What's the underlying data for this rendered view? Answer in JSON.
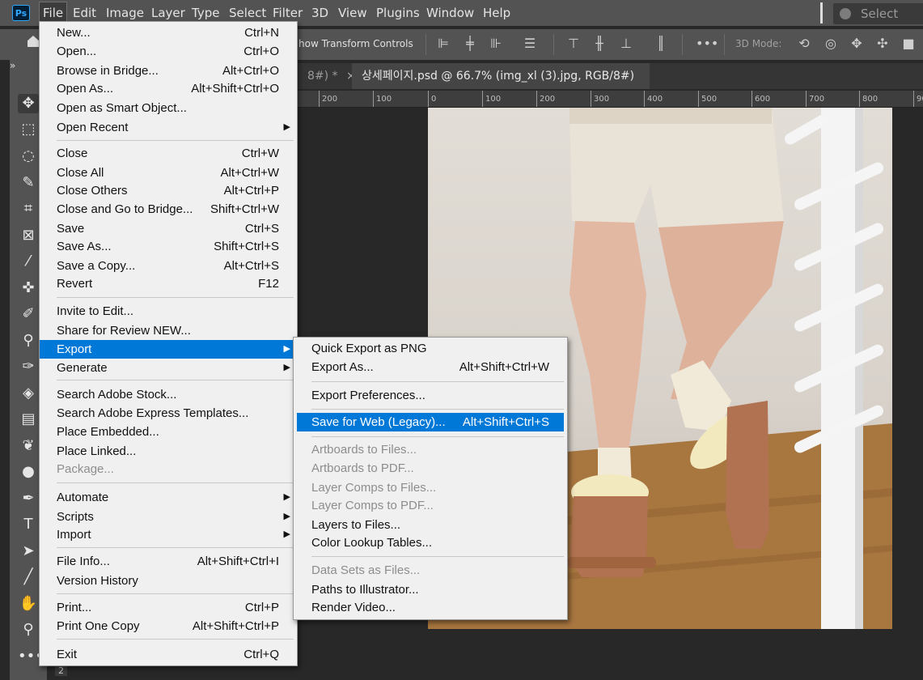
{
  "app": {
    "logo_text": "Ps"
  },
  "menubar": {
    "items": [
      "File",
      "Edit",
      "Image",
      "Layer",
      "Type",
      "Select",
      "Filter",
      "3D",
      "View",
      "Plugins",
      "Window",
      "Help"
    ],
    "select_subject": "Select subje"
  },
  "options_bar": {
    "transform_label": "how Transform Controls",
    "mode3d": "3D Mode:"
  },
  "tabs": {
    "inactive_tab": "8#) *",
    "active_tab": "상세페이지.psd @ 66.7% (img_xl (3).jpg, RGB/8#) *",
    "close_glyph": "×"
  },
  "ruler": {
    "ticks": [
      "200",
      "100",
      "0",
      "100",
      "200",
      "300",
      "400",
      "500",
      "600",
      "700",
      "800",
      "90"
    ]
  },
  "tool_panel": {
    "collapse": "»",
    "bottom_label": "2"
  },
  "file_menu": {
    "items": [
      {
        "label": "New...",
        "shortcut": "Ctrl+N"
      },
      {
        "label": "Open...",
        "shortcut": "Ctrl+O"
      },
      {
        "label": "Browse in Bridge...",
        "shortcut": "Alt+Ctrl+O"
      },
      {
        "label": "Open As...",
        "shortcut": "Alt+Shift+Ctrl+O"
      },
      {
        "label": "Open as Smart Object...",
        "shortcut": ""
      },
      {
        "label": "Open Recent",
        "shortcut": "",
        "submenu": true
      },
      {
        "label": "Close",
        "shortcut": "Ctrl+W"
      },
      {
        "label": "Close All",
        "shortcut": "Alt+Ctrl+W"
      },
      {
        "label": "Close Others",
        "shortcut": "Alt+Ctrl+P"
      },
      {
        "label": "Close and Go to Bridge...",
        "shortcut": "Shift+Ctrl+W"
      },
      {
        "label": "Save",
        "shortcut": "Ctrl+S"
      },
      {
        "label": "Save As...",
        "shortcut": "Shift+Ctrl+S"
      },
      {
        "label": "Save a Copy...",
        "shortcut": "Alt+Ctrl+S"
      },
      {
        "label": "Revert",
        "shortcut": "F12"
      },
      {
        "label": "Invite to Edit...",
        "shortcut": ""
      },
      {
        "label": "Share for Review NEW...",
        "shortcut": ""
      },
      {
        "label": "Export",
        "shortcut": "",
        "submenu": true,
        "highlighted": true
      },
      {
        "label": "Generate",
        "shortcut": "",
        "submenu": true
      },
      {
        "label": "Search Adobe Stock...",
        "shortcut": ""
      },
      {
        "label": "Search Adobe Express Templates...",
        "shortcut": ""
      },
      {
        "label": "Place Embedded...",
        "shortcut": ""
      },
      {
        "label": "Place Linked...",
        "shortcut": ""
      },
      {
        "label": "Package...",
        "shortcut": "",
        "disabled": true
      },
      {
        "label": "Automate",
        "shortcut": "",
        "submenu": true
      },
      {
        "label": "Scripts",
        "shortcut": "",
        "submenu": true
      },
      {
        "label": "Import",
        "shortcut": "",
        "submenu": true
      },
      {
        "label": "File Info...",
        "shortcut": "Alt+Shift+Ctrl+I"
      },
      {
        "label": "Version History",
        "shortcut": ""
      },
      {
        "label": "Print...",
        "shortcut": "Ctrl+P"
      },
      {
        "label": "Print One Copy",
        "shortcut": "Alt+Shift+Ctrl+P"
      },
      {
        "label": "Exit",
        "shortcut": "Ctrl+Q"
      }
    ]
  },
  "export_menu": {
    "items": [
      {
        "label": "Quick Export as PNG",
        "shortcut": ""
      },
      {
        "label": "Export As...",
        "shortcut": "Alt+Shift+Ctrl+W"
      },
      {
        "label": "Export Preferences...",
        "shortcut": ""
      },
      {
        "label": "Save for Web (Legacy)...",
        "shortcut": "Alt+Shift+Ctrl+S",
        "highlighted": true
      },
      {
        "label": "Artboards to Files...",
        "shortcut": "",
        "disabled": true
      },
      {
        "label": "Artboards to PDF...",
        "shortcut": "",
        "disabled": true
      },
      {
        "label": "Layer Comps to Files...",
        "shortcut": "",
        "disabled": true
      },
      {
        "label": "Layer Comps to PDF...",
        "shortcut": "",
        "disabled": true
      },
      {
        "label": "Layers to Files...",
        "shortcut": ""
      },
      {
        "label": "Color Lookup Tables...",
        "shortcut": ""
      },
      {
        "label": "Data Sets as Files...",
        "shortcut": "",
        "disabled": true
      },
      {
        "label": "Paths to Illustrator...",
        "shortcut": ""
      },
      {
        "label": "Render Video...",
        "shortcut": ""
      }
    ]
  },
  "colors": {
    "highlight": "#0078d7",
    "menu_bg": "#f0f0f0",
    "ui_gray": "#535353"
  }
}
